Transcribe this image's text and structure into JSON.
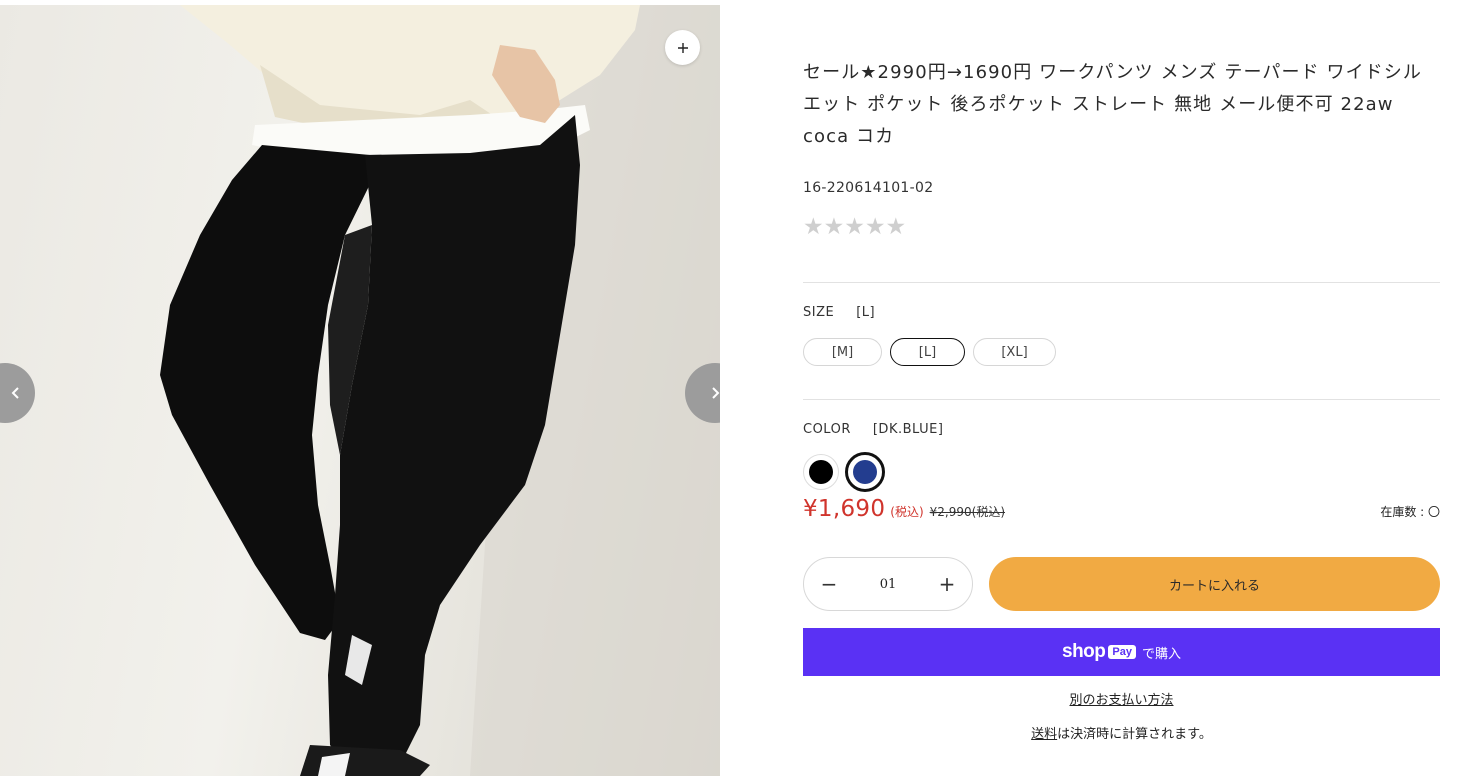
{
  "product": {
    "title": "セール★2990円→1690円 ワークパンツ メンズ テーパード ワイドシルエット ポケット 後ろポケット ストレート 無地 メール便不可 22aw coca コカ",
    "sku": "16-220614101-02",
    "rating_stars": "★★★★★",
    "rating_value": 0,
    "rating_max": 5
  },
  "options": {
    "size_label": "SIZE",
    "size_selected": "[L]",
    "sizes": [
      "[M]",
      "[L]",
      "[XL]"
    ],
    "color_label": "COLOR",
    "color_selected": "[DK.BLUE]",
    "colors": [
      {
        "name": "BLACK",
        "hex": "#000000"
      },
      {
        "name": "DK.BLUE",
        "hex": "#233d8f"
      }
    ]
  },
  "price": {
    "current": "¥1,690",
    "tax_note": "(税込)",
    "original": "¥2,990(税込)",
    "stock": "在庫数 : 〇",
    "sale_color": "#d0342c"
  },
  "cart": {
    "quantity": "01",
    "minus": "−",
    "plus": "+",
    "add_to_cart": "カートに入れる",
    "button_color": "#f1aa43"
  },
  "shop_pay": {
    "shop": "shop",
    "pay": "Pay",
    "buy": "で購入",
    "color": "#5a31f4"
  },
  "more_payment": "別のお支払い方法",
  "shipping": {
    "link": "送料",
    "rest": "は決済時に計算されます。"
  }
}
